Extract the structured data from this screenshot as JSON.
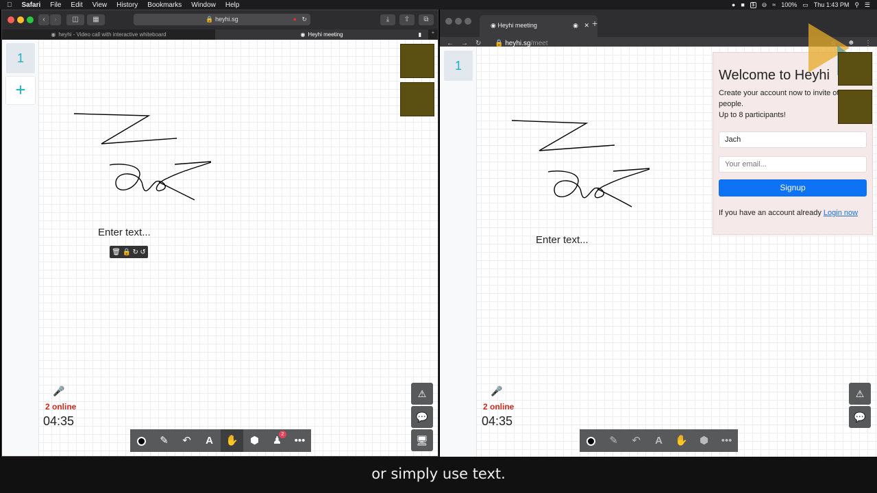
{
  "menubar": {
    "items": [
      "Safari",
      "File",
      "Edit",
      "View",
      "History",
      "Bookmarks",
      "Window",
      "Help"
    ],
    "battery": "100%",
    "clock": "Thu 1:43 PM"
  },
  "safari": {
    "url": "heyhi.sg",
    "tabs": [
      "heyhi - Video call with interactive whiteboard",
      "Heyhi meeting"
    ]
  },
  "chrome": {
    "tab_title": "Heyhi meeting",
    "url_domain": "heyhi.sg",
    "url_path": "/meet"
  },
  "whiteboard": {
    "page_number": "1",
    "add_page": "+",
    "online_count": "2 online",
    "timer": "04:35",
    "text_placeholder": "Enter text...",
    "participants_badge": "2"
  },
  "signup": {
    "title": "Welcome to Heyhi",
    "line1": "Create your account now to invite ot",
    "line2": "people.",
    "line3": "Up to 8 participants!",
    "name_value": "Jach",
    "email_placeholder": "Your email...",
    "button": "Signup",
    "login_prompt": "If you have an account already",
    "login_link": "Login now"
  },
  "caption": "or simply use text.",
  "colors": {
    "accent": "#1ab2c7",
    "online": "#d0281a",
    "signup_button": "#0d72f3",
    "toolbar": "#58595b"
  }
}
